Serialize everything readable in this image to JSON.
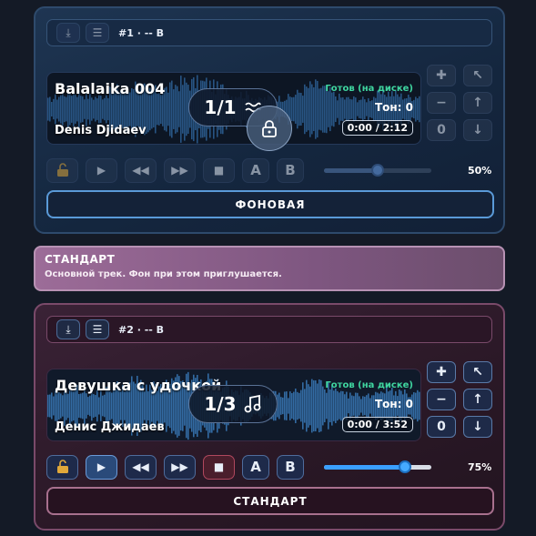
{
  "deck1": {
    "header": {
      "download_icon": "download-icon",
      "menu_icon": "menu-icon",
      "label": "#1 · -- B"
    },
    "track": {
      "title": "Balalaika 004",
      "artist": "Denis Djidaev",
      "status": "Готов (на диске)",
      "tone": "Тон: 0",
      "time": "0:00 / 2:12",
      "counter": "1/1",
      "counter_icon": "wave-icon",
      "locked": true
    },
    "side_buttons": {
      "plus": "✚",
      "minus": "−",
      "reset": "0",
      "expand": "↖",
      "up": "↑",
      "down": "↓"
    },
    "controls": {
      "a_label": "A",
      "b_label": "B",
      "volume": 0.5,
      "volume_label": "50%"
    },
    "mode_label": "ФОНОВАЯ",
    "enabled": false
  },
  "info": {
    "title": "СТАНДАРТ",
    "description": "Основной трек. Фон при этом приглушается."
  },
  "deck2": {
    "header": {
      "download_icon": "download-icon",
      "menu_icon": "menu-icon",
      "label": "#2 · -- B"
    },
    "track": {
      "title": "Девушка с удочкой",
      "artist": "Денис Джидаев",
      "status": "Готов (на диске)",
      "tone": "Тон: 0",
      "time": "0:00 / 3:52",
      "counter": "1/3",
      "counter_icon": "music-note-icon",
      "locked": false
    },
    "side_buttons": {
      "plus": "✚",
      "minus": "−",
      "reset": "0",
      "expand": "↖",
      "up": "↑",
      "down": "↓"
    },
    "controls": {
      "a_label": "A",
      "b_label": "B",
      "volume": 0.75,
      "volume_label": "75%"
    },
    "mode_label": "СТАНДАРТ",
    "enabled": true
  },
  "colors": {
    "accent_blue": "#3aa0ff",
    "status_green": "#3fd6a0",
    "stop_red": "#b0485e",
    "info_purple": "#9c6c98"
  }
}
